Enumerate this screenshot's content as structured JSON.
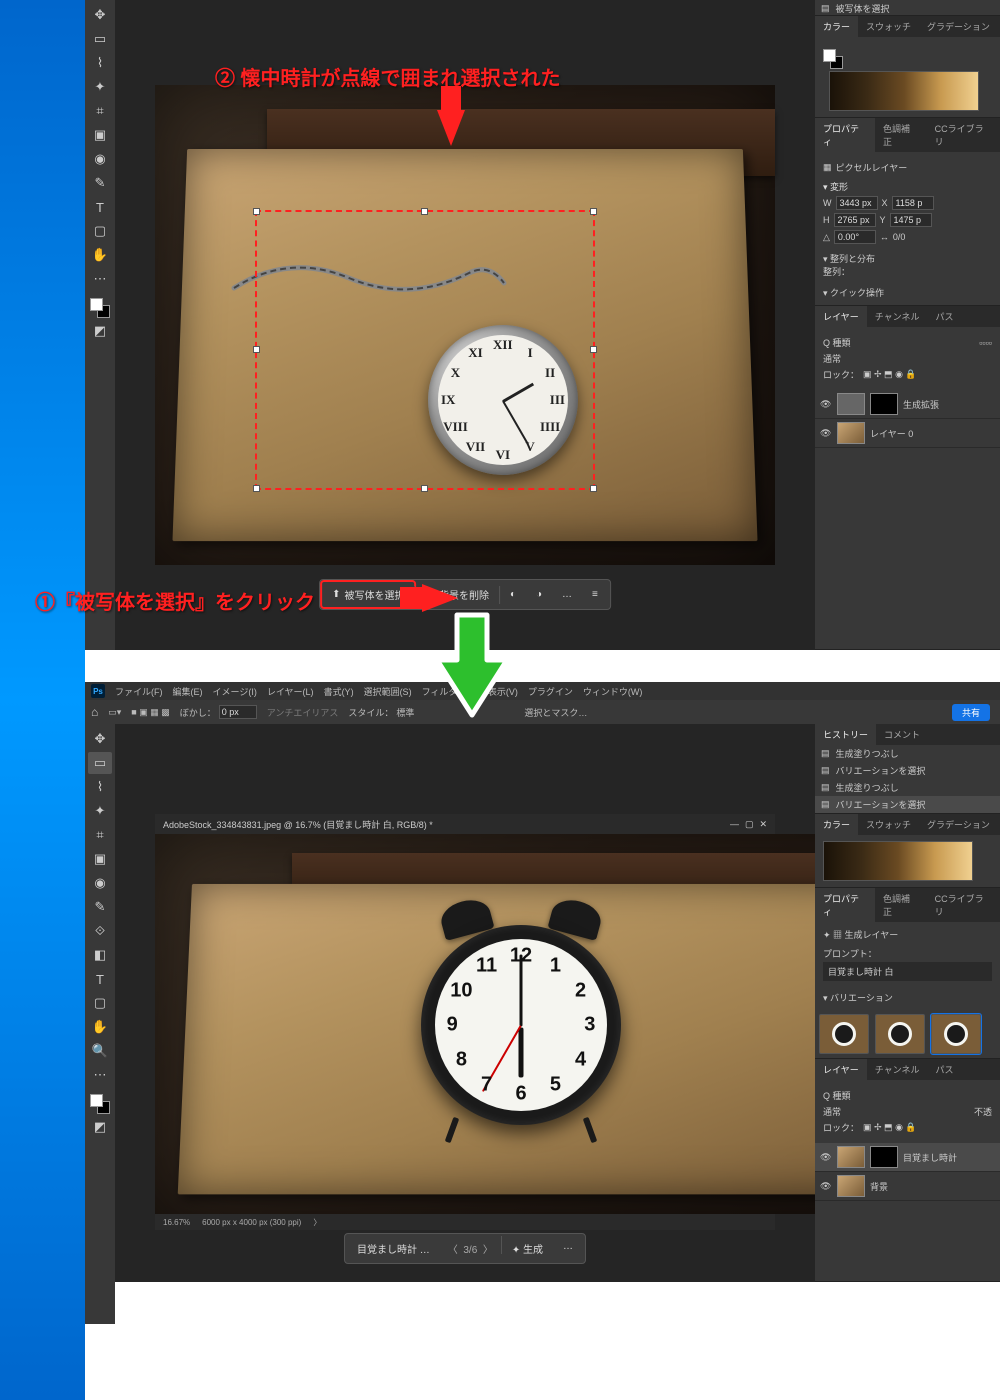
{
  "annotations": {
    "step1": "①『被写体を選択』をクリック",
    "step2": "② 懐中時計が点線で囲まれ選択された"
  },
  "shot1": {
    "context_bar": {
      "select_subject": "被写体を選択",
      "remove_background": "背景を削除",
      "more": "…"
    },
    "panels": {
      "color_tabs": [
        "カラー",
        "スウォッチ",
        "グラデーション"
      ],
      "prop_tabs": [
        "プロパティ",
        "色調補正",
        "CCライブラリ"
      ],
      "pixel_layer": "ピクセルレイヤー",
      "transform_header": "変形",
      "w": "3443 px",
      "x": "1158 p",
      "h": "2765 px",
      "y": "1475 p",
      "angle": "0.00°",
      "flip": "0/0",
      "align_header": "整列と分布",
      "align_label": "整列：",
      "quick_header": "クイック操作",
      "layer_tabs": [
        "レイヤー",
        "チャンネル",
        "パス"
      ],
      "blend": "Q 種類",
      "opacity": "通常",
      "lock": "ロック：",
      "layer1": "生成拡張",
      "layer2": "レイヤー 0"
    }
  },
  "shot2": {
    "menu": [
      "ファイル(F)",
      "編集(E)",
      "イメージ(I)",
      "レイヤー(L)",
      "書式(Y)",
      "選択範囲(S)",
      "フィルター(T)",
      "表示(V)",
      "プラグイン",
      "ウィンドウ(W)"
    ],
    "optbar": {
      "feather_label": "ぼかし：",
      "feather_value": "0 px",
      "antialias": "アンチエイリアス",
      "style_label": "スタイル：",
      "style_value": "標準",
      "select_mask": "選択とマスク…",
      "share": "共有"
    },
    "doc_title": "AdobeStock_334843831.jpeg @ 16.7% (目覚まし時計 白, RGB/8) *",
    "status_zoom": "16.67%",
    "status_dims": "6000 px x 4000 px (300 ppi)",
    "context_bar": {
      "prompt": "目覚まし時計 …",
      "page": "3/6",
      "generate": "生成",
      "more": "…"
    },
    "panels": {
      "hist_tabs": [
        "ヒストリー",
        "コメント"
      ],
      "hist": [
        "生成塗りつぶし",
        "バリエーションを選択",
        "生成塗りつぶし",
        "バリエーションを選択"
      ],
      "color_tabs": [
        "カラー",
        "スウォッチ",
        "グラデーション"
      ],
      "prop_tabs": [
        "プロパティ",
        "色調補正",
        "CCライブラリ"
      ],
      "gen_layer": "生成レイヤー",
      "prompt_label": "プロンプト：",
      "prompt_value": "目覚まし時計 白",
      "variations_header": "バリエーション",
      "layer_tabs": [
        "レイヤー",
        "チャンネル",
        "パス"
      ],
      "blend": "Q 種類",
      "opacity1": "通常",
      "opacity2": "不透",
      "lock": "ロック：",
      "layer1": "目覚まし時計",
      "layer2": "背景"
    }
  },
  "clockface": {
    "roman": [
      "XII",
      "I",
      "II",
      "III",
      "IIII",
      "V",
      "VI",
      "VII",
      "VIII",
      "IX",
      "X",
      "XI"
    ],
    "arabic": [
      "12",
      "1",
      "2",
      "3",
      "4",
      "5",
      "6",
      "7",
      "8",
      "9",
      "10",
      "11"
    ]
  }
}
